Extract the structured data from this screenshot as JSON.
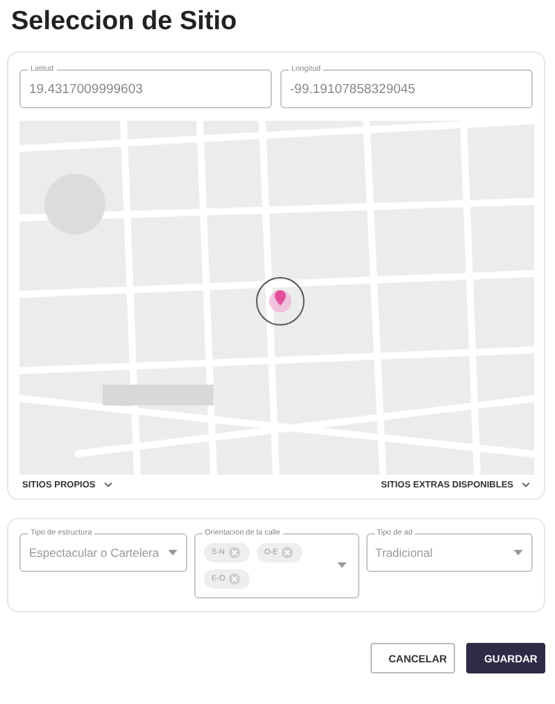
{
  "title": "Seleccion de Sitio",
  "coords": [
    {
      "label": "Latitud",
      "value": "19.4317009999603"
    },
    {
      "label": "Longitud",
      "value": "-99.19107858329045"
    }
  ],
  "map_menus": [
    "SITIOS PROPIOS",
    "SITIOS EXTRAS DISPONIBLES"
  ],
  "filters": [
    {
      "kind": "select",
      "label": "Tipo de estructura",
      "value": "Espectacular o Cartelera"
    },
    {
      "kind": "chips",
      "label": "Orientación de la calle",
      "chips": [
        "S-N",
        "O-E",
        "E-O"
      ]
    },
    {
      "kind": "select",
      "label": "Tipo de ad",
      "value": "Tradicional"
    }
  ],
  "buttons": [
    {
      "kind": "outlined",
      "label": "CANCELAR"
    },
    {
      "kind": "filled",
      "label": "GUARDAR"
    }
  ]
}
